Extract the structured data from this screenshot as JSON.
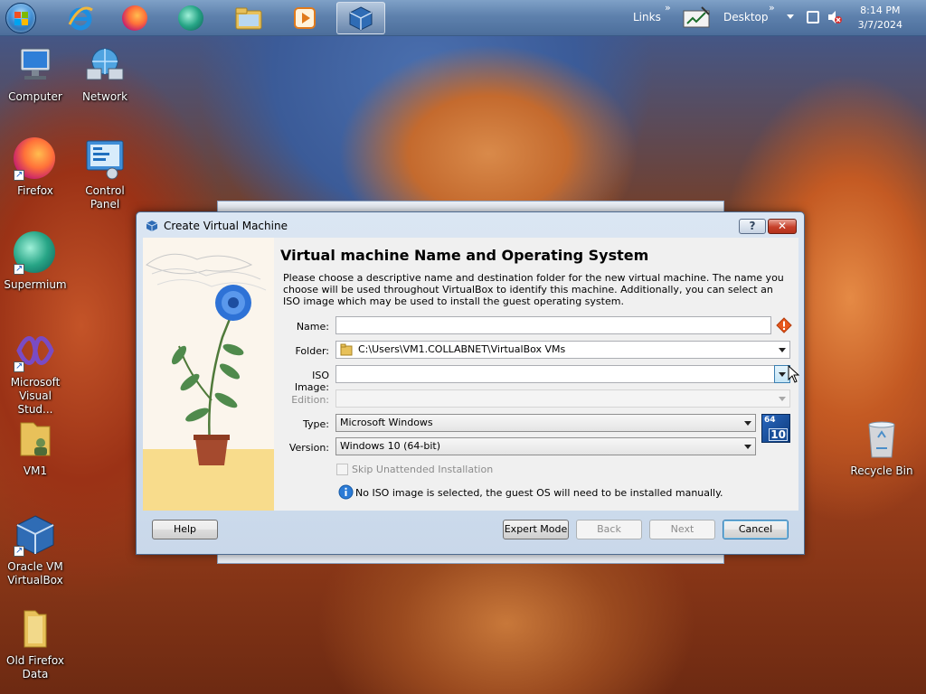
{
  "taskbar": {
    "pinned": [
      {
        "name": "internet-explorer"
      },
      {
        "name": "firefox"
      },
      {
        "name": "supermium"
      },
      {
        "name": "file-explorer"
      },
      {
        "name": "media-player"
      },
      {
        "name": "virtualbox",
        "active": true
      }
    ],
    "links_label": "Links",
    "links_chevron": "»",
    "desktop_label": "Desktop",
    "desktop_chevron": "»",
    "clock_time": "8:14 PM",
    "clock_date": "3/7/2024"
  },
  "desktop_icons": {
    "computer": "Computer",
    "network": "Network",
    "firefox": "Firefox",
    "control_panel": "Control Panel",
    "supermium": "Supermium",
    "visual_studio": "Microsoft Visual Stud...",
    "vm1": "VM1",
    "virtualbox": "Oracle VM VirtualBox",
    "old_firefox": "Old Firefox Data",
    "recycle_bin": "Recycle Bin"
  },
  "dialog": {
    "title": "Create Virtual Machine",
    "help_glyph": "?",
    "close_glyph": "✕",
    "heading": "Virtual machine Name and Operating System",
    "description": "Please choose a descriptive name and destination folder for the new virtual machine. The name you choose will be used throughout VirtualBox to identify this machine. Additionally, you can select an ISO image which may be used to install the guest operating system.",
    "fields": {
      "name_label": "Name:",
      "name_value": "",
      "folder_label": "Folder:",
      "folder_value": "C:\\Users\\VM1.COLLABNET\\VirtualBox VMs",
      "iso_label": "ISO Image:",
      "iso_value": "",
      "edition_label": "Edition:",
      "edition_value": "",
      "type_label": "Type:",
      "type_value": "Microsoft Windows",
      "version_label": "Version:",
      "version_value": "Windows 10 (64-bit)",
      "os_badge_top": "64",
      "os_badge_bottom": "10"
    },
    "skip_unattended_label": "Skip Unattended Installation",
    "skip_unattended_checked": false,
    "info_message": "No ISO image is selected, the guest OS will need to be installed manually.",
    "buttons": {
      "help": "Help",
      "expert_mode": "Expert Mode",
      "back": "Back",
      "next": "Next",
      "cancel": "Cancel"
    }
  },
  "colors": {
    "titlebar": "#dbe6f3",
    "accent_blue": "#3c7fb1",
    "warning": "#e8581d",
    "info": "#2b7bd6"
  }
}
